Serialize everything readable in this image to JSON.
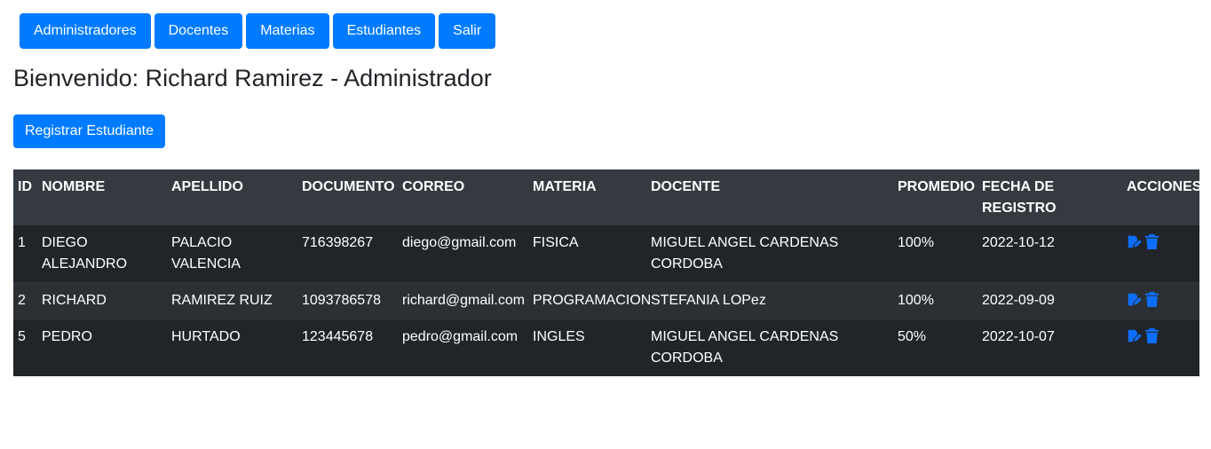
{
  "nav": {
    "items": [
      {
        "label": "Administradores"
      },
      {
        "label": "Docentes"
      },
      {
        "label": "Materias"
      },
      {
        "label": "Estudiantes"
      },
      {
        "label": "Salir"
      }
    ]
  },
  "welcome": "Bienvenido: Richard Ramirez - Administrador",
  "register_label": "Registrar Estudiante",
  "colors": {
    "primary": "#007bff",
    "table_header": "#343a40",
    "table_row": "#212529",
    "icon": "#0d6efd"
  },
  "table": {
    "headers": [
      "ID",
      "NOMBRE",
      "APELLIDO",
      "DOCUMENTO",
      "CORREO",
      "MATERIA",
      "DOCENTE",
      "PROMEDIO",
      "FECHA DE REGISTRO",
      "ACCIONES"
    ],
    "rows": [
      {
        "id": "1",
        "nombre": "DIEGO ALEJANDRO",
        "apellido": "PALACIO VALENCIA",
        "documento": "716398267",
        "correo": "diego@gmail.com",
        "materia": "FISICA",
        "docente": "MIGUEL ANGEL CARDENAS CORDOBA",
        "promedio": "100%",
        "fecha": "2022-10-12"
      },
      {
        "id": "2",
        "nombre": "RICHARD",
        "apellido": "RAMIREZ RUIZ",
        "documento": "1093786578",
        "correo": "richard@gmail.com",
        "materia": "PROGRAMACION",
        "docente": "STEFANIA LOPez",
        "promedio": "100%",
        "fecha": "2022-09-09"
      },
      {
        "id": "5",
        "nombre": "PEDRO",
        "apellido": "HURTADO",
        "documento": "123445678",
        "correo": "pedro@gmail.com",
        "materia": "INGLES",
        "docente": "MIGUEL ANGEL CARDENAS CORDOBA",
        "promedio": "50%",
        "fecha": "2022-10-07"
      }
    ],
    "action_icons": [
      "edit-icon",
      "trash-icon"
    ]
  }
}
